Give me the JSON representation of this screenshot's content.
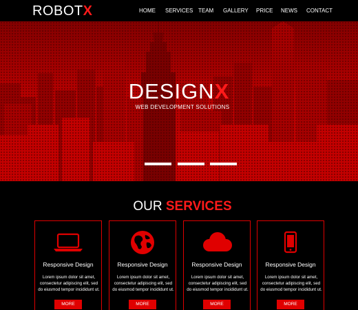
{
  "brand": {
    "logo_main": "ROBOT",
    "logo_accent": "X"
  },
  "nav": {
    "items": [
      "HOME",
      "SERVICES",
      "TEAM",
      "GALLERY",
      "PRICE",
      "NEWS",
      "CONTACT"
    ]
  },
  "hero": {
    "title_main": "DESIGN",
    "title_accent": "X",
    "subtitle": "WEB DEVELOPMENT SOLUTIONS",
    "slides": 3
  },
  "services": {
    "heading_main": "OUR",
    "heading_accent": "SERVICES",
    "cards": [
      {
        "icon": "laptop-icon",
        "title": "Responsive Design",
        "text": "Lorem ipsum dolor sit amet, consectetur adipiscing elit, sed do eiusmod tempor incididunt ut.",
        "button": "MORE"
      },
      {
        "icon": "globe-icon",
        "title": "Responsive Design",
        "text": "Lorem ipsum dolor sit amet, consectetur adipiscing elit, sed do eiusmod tempor incididunt ut.",
        "button": "MORE"
      },
      {
        "icon": "cloud-icon",
        "title": "Responsive Design",
        "text": "Lorem ipsum dolor sit amet, consectetur adipiscing elit, sed do eiusmod tempor incididunt ut.",
        "button": "MORE"
      },
      {
        "icon": "mobile-icon",
        "title": "Responsive Design",
        "text": "Lorem ipsum dolor sit amet, consectetur adipiscing elit, sed do eiusmod tempor incididunt ut.",
        "button": "MORE"
      }
    ]
  },
  "colors": {
    "accent": "#e00000",
    "background": "#000000",
    "text": "#ffffff"
  }
}
